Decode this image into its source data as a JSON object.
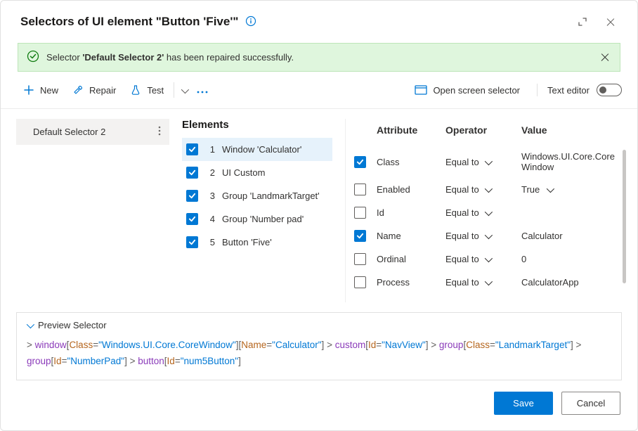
{
  "header": {
    "title": "Selectors of UI element \"Button 'Five'\""
  },
  "banner": {
    "prefix": "Selector ",
    "strong": "'Default Selector 2'",
    "suffix": " has been repaired successfully."
  },
  "toolbar": {
    "new_label": "New",
    "repair_label": "Repair",
    "test_label": "Test",
    "open_screen_label": "Open screen selector",
    "text_editor_label": "Text editor"
  },
  "sidebar": {
    "items": [
      {
        "label": "Default Selector 2"
      }
    ]
  },
  "elements": {
    "heading": "Elements",
    "rows": [
      {
        "idx": "1",
        "label": "Window 'Calculator'",
        "checked": true,
        "selected": true
      },
      {
        "idx": "2",
        "label": "UI Custom",
        "checked": true,
        "selected": false
      },
      {
        "idx": "3",
        "label": "Group 'LandmarkTarget'",
        "checked": true,
        "selected": false
      },
      {
        "idx": "4",
        "label": "Group 'Number pad'",
        "checked": true,
        "selected": false
      },
      {
        "idx": "5",
        "label": "Button 'Five'",
        "checked": true,
        "selected": false
      }
    ]
  },
  "attributes": {
    "head_attr": "Attribute",
    "head_op": "Operator",
    "head_val": "Value",
    "rows": [
      {
        "checked": true,
        "name": "Class",
        "op": "Equal to",
        "value": "Windows.UI.Core.CoreWindow",
        "value_dropdown": false
      },
      {
        "checked": false,
        "name": "Enabled",
        "op": "Equal to",
        "value": "True",
        "value_dropdown": true
      },
      {
        "checked": false,
        "name": "Id",
        "op": "Equal to",
        "value": "",
        "value_dropdown": false
      },
      {
        "checked": true,
        "name": "Name",
        "op": "Equal to",
        "value": "Calculator",
        "value_dropdown": false
      },
      {
        "checked": false,
        "name": "Ordinal",
        "op": "Equal to",
        "value": "0",
        "value_dropdown": false
      },
      {
        "checked": false,
        "name": "Process",
        "op": "Equal to",
        "value": "CalculatorApp",
        "value_dropdown": false
      }
    ]
  },
  "preview": {
    "heading": "Preview Selector",
    "tokens": [
      {
        "t": "op",
        "v": "> "
      },
      {
        "t": "elem",
        "v": "window"
      },
      {
        "t": "op",
        "v": "["
      },
      {
        "t": "attr",
        "v": "Class"
      },
      {
        "t": "op",
        "v": "="
      },
      {
        "t": "val",
        "v": "\"Windows.UI.Core.CoreWindow\""
      },
      {
        "t": "op",
        "v": "]"
      },
      {
        "t": "op",
        "v": "["
      },
      {
        "t": "attr",
        "v": "Name"
      },
      {
        "t": "op",
        "v": "="
      },
      {
        "t": "val",
        "v": "\"Calculator\""
      },
      {
        "t": "op",
        "v": "]"
      },
      {
        "t": "op",
        "v": " > "
      },
      {
        "t": "elem",
        "v": "custom"
      },
      {
        "t": "op",
        "v": "["
      },
      {
        "t": "attr",
        "v": "Id"
      },
      {
        "t": "op",
        "v": "="
      },
      {
        "t": "val",
        "v": "\"NavView\""
      },
      {
        "t": "op",
        "v": "]"
      },
      {
        "t": "op",
        "v": " > "
      },
      {
        "t": "elem",
        "v": "group"
      },
      {
        "t": "op",
        "v": "["
      },
      {
        "t": "attr",
        "v": "Class"
      },
      {
        "t": "op",
        "v": "="
      },
      {
        "t": "val",
        "v": "\"LandmarkTarget\""
      },
      {
        "t": "op",
        "v": "]"
      },
      {
        "t": "op",
        "v": " > "
      },
      {
        "t": "elem",
        "v": "group"
      },
      {
        "t": "op",
        "v": "["
      },
      {
        "t": "attr",
        "v": "Id"
      },
      {
        "t": "op",
        "v": "="
      },
      {
        "t": "val",
        "v": "\"NumberPad\""
      },
      {
        "t": "op",
        "v": "]"
      },
      {
        "t": "op",
        "v": " > "
      },
      {
        "t": "elem",
        "v": "button"
      },
      {
        "t": "op",
        "v": "["
      },
      {
        "t": "attr",
        "v": "Id"
      },
      {
        "t": "op",
        "v": "="
      },
      {
        "t": "val",
        "v": "\"num5Button\""
      },
      {
        "t": "op",
        "v": "]"
      }
    ]
  },
  "footer": {
    "save": "Save",
    "cancel": "Cancel"
  }
}
